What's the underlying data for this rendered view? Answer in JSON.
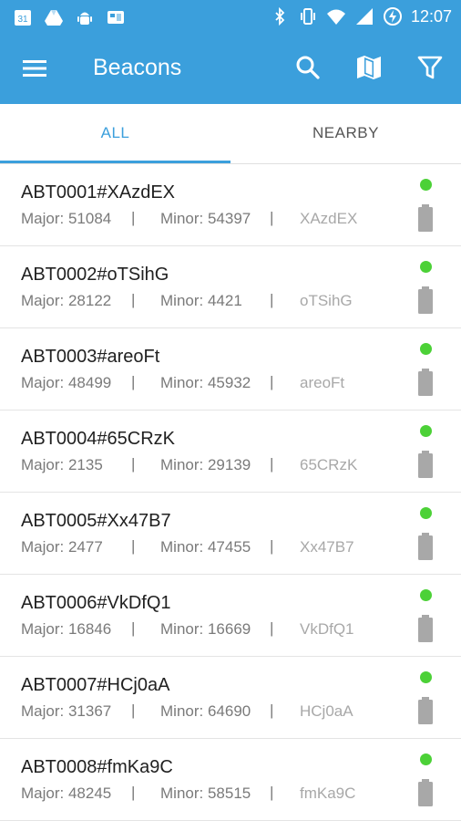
{
  "status_bar": {
    "time": "12:07",
    "icons_left": [
      "calendar-icon",
      "drive-icon",
      "android-icon",
      "gallery-icon"
    ],
    "icons_right": [
      "bluetooth-icon",
      "vibrate-icon",
      "wifi-icon",
      "cellular-icon",
      "battery-charging-icon"
    ],
    "calendar_day": "31"
  },
  "app_bar": {
    "title": "Beacons",
    "actions": [
      "search-icon",
      "map-icon",
      "filter-icon"
    ]
  },
  "tabs": [
    {
      "label": "ALL",
      "selected": true
    },
    {
      "label": "NEARBY",
      "selected": false
    }
  ],
  "colors": {
    "primary": "#3b9fdc",
    "status_online": "#4cd137",
    "battery": "#a8a8a8"
  },
  "beacons": [
    {
      "name": "ABT0001#XAzdEX",
      "major": "Major: 51084",
      "minor": "Minor: 54397",
      "code": "XAzdEX"
    },
    {
      "name": "ABT0002#oTSihG",
      "major": "Major: 28122",
      "minor": "Minor: 4421",
      "code": "oTSihG"
    },
    {
      "name": "ABT0003#areoFt",
      "major": "Major: 48499",
      "minor": "Minor: 45932",
      "code": "areoFt"
    },
    {
      "name": "ABT0004#65CRzK",
      "major": "Major: 2135",
      "minor": "Minor: 29139",
      "code": "65CRzK"
    },
    {
      "name": "ABT0005#Xx47B7",
      "major": "Major: 2477",
      "minor": "Minor: 47455",
      "code": "Xx47B7"
    },
    {
      "name": "ABT0006#VkDfQ1",
      "major": "Major: 16846",
      "minor": "Minor: 16669",
      "code": "VkDfQ1"
    },
    {
      "name": "ABT0007#HCj0aA",
      "major": "Major: 31367",
      "minor": "Minor: 64690",
      "code": "HCj0aA"
    },
    {
      "name": "ABT0008#fmKa9C",
      "major": "Major: 48245",
      "minor": "Minor: 58515",
      "code": "fmKa9C"
    }
  ],
  "separator": "|"
}
